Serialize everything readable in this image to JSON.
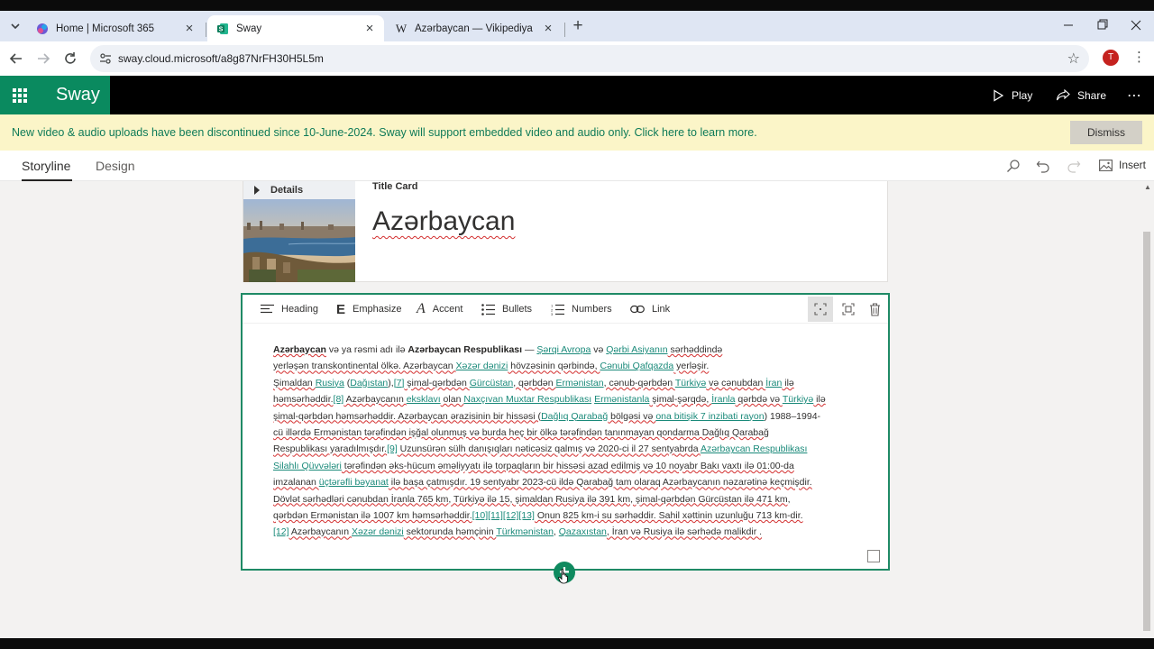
{
  "browser": {
    "tabs": [
      {
        "label": "Home | Microsoft 365",
        "icon": "microsoft365-icon",
        "active": false
      },
      {
        "label": "Sway",
        "icon": "sway-icon",
        "active": true
      },
      {
        "label": "Azərbaycan — Vikipediya",
        "icon": "wikipedia-icon",
        "active": false
      }
    ],
    "url": "sway.cloud.microsoft/a8g87NrFH30H5L5m",
    "profile_initial": "T"
  },
  "app": {
    "brand": "Sway",
    "brand_color": "#0a8a5f",
    "header_actions": {
      "play": "Play",
      "share": "Share"
    }
  },
  "notice": {
    "text": "New video & audio uploads have been discontinued since 10-June-2024. Sway will support embedded video and audio only. Click here to learn more.",
    "dismiss": "Dismiss"
  },
  "nav": {
    "storyline": "Storyline",
    "design": "Design",
    "insert": "Insert"
  },
  "title_card": {
    "details": "Details",
    "card_type": "Title Card",
    "title": "Azərbaycan"
  },
  "text_card": {
    "toolbar": {
      "heading": "Heading",
      "emphasize": "Emphasize",
      "accent": "Accent",
      "bullets": "Bullets",
      "numbers": "Numbers",
      "link": "Link"
    },
    "body": {
      "t01": "Azərbaycan",
      "t02": " və ya rəsmi adı ilə ",
      "t03": "Azərbaycan Respublikası",
      "t04": " — ",
      "t05": "Şərqi Avropa",
      "t06": " və ",
      "t07": "Qərbi Asiyanın",
      "t08": " sərhəddində",
      "t09": "yerləşən transkontinental ölkə. Azərbaycan ",
      "t10": "Xəzər dənizi",
      "t11": " hövzəsinin qərbində, ",
      "t12": "Cənubi Qafqazda",
      "t13": " yerləşir.",
      "t14": "Şimaldan ",
      "t15": "Rusiya",
      "t16": " (",
      "t17": "Dağıstan",
      "t18": "),",
      "t19": "[7]",
      "t20": " şimal-qərbdən ",
      "t21": "Gürcüstan",
      "t22": ", qərbdən ",
      "t23": "Ermənistan",
      "t24": ", cənub-qərbdən ",
      "t25": "Türkiyə",
      "t26": " və cənubdan ",
      "t27": "İran",
      "t28": " ilə",
      "t29": "həmsərhəddir.",
      "t30": "[8]",
      "t31": " Azərbaycanın ",
      "t32": "eksklavı",
      "t33": " olan ",
      "t34": "Naxçıvan Muxtar Respublikası",
      "t35": " ",
      "t36": "Ermənistanla",
      "t37": " şimal-şərqdə, ",
      "t38": "İranla",
      "t39": " qərbdə və ",
      "t40": "Türkiyə",
      "t41": " ilə",
      "t42": "şimal-qərbdən həmsərhəddir. Azərbaycan ərazisinin bir hissəsi (",
      "t43": "Dağlıq Qarabağ",
      "t44": " bölgəsi və ",
      "t45": "ona bitişik 7 inzibati rayon",
      "t46": ") 1988–1994-",
      "t47": "cü illərdə Ermənistan tərəfindən işğal olunmuş və burda heç bir ölkə tərəfindən tanınmayan qondarma Dağlıq Qarabağ",
      "t48": "Respublikası yaradılmışdır.",
      "t49": "[9]",
      "t50": " Uzunsürən sülh danışıqları nəticəsiz qalmış və 2020-ci il 27 sentyabrda ",
      "t51": "Azərbaycan Respublikası",
      "t52": "Silahlı Qüvvələri",
      "t53": " tərəfindən əks-hücum əməliyyatı ilə torpaqların bir hissəsi azad edilmiş və 10 noyabr Bakı vaxtı ilə 01:00-da",
      "t54": "imzalanan ",
      "t55": "üçtərəfli bəyanat",
      "t56": " ilə başa çatmışdır. 19 sentyabr 2023-cü ildə Qarabağ tam olaraq Azərbaycanın nəzarətinə keçmişdir.",
      "t57": "Dövlət sərhədləri cənubdan İranla 765 km, Türkiyə ilə 15, şimaldan Rusiya ilə 391 km, şimal-qərbdən Gürcüstan ilə 471 km,",
      "t58": "qərbdən Ermənistan ilə 1007 km həmsərhəddir.",
      "t59": "[10][11][12][13]",
      "t60": " Onun 825 km-i su sərhəddir. Sahil xəttinin uzunluğu 713 km-dir.",
      "t61": "[12]",
      "t62": " Azərbaycanın ",
      "t63": "Xəzər dənizi",
      "t64": " sektorunda həmçinin ",
      "t65": "Türkmənistan",
      "t66": ", ",
      "t67": "Qazaxıstan",
      "t68": ", İran və Rusiya ilə sərhədə malikdir ."
    }
  }
}
